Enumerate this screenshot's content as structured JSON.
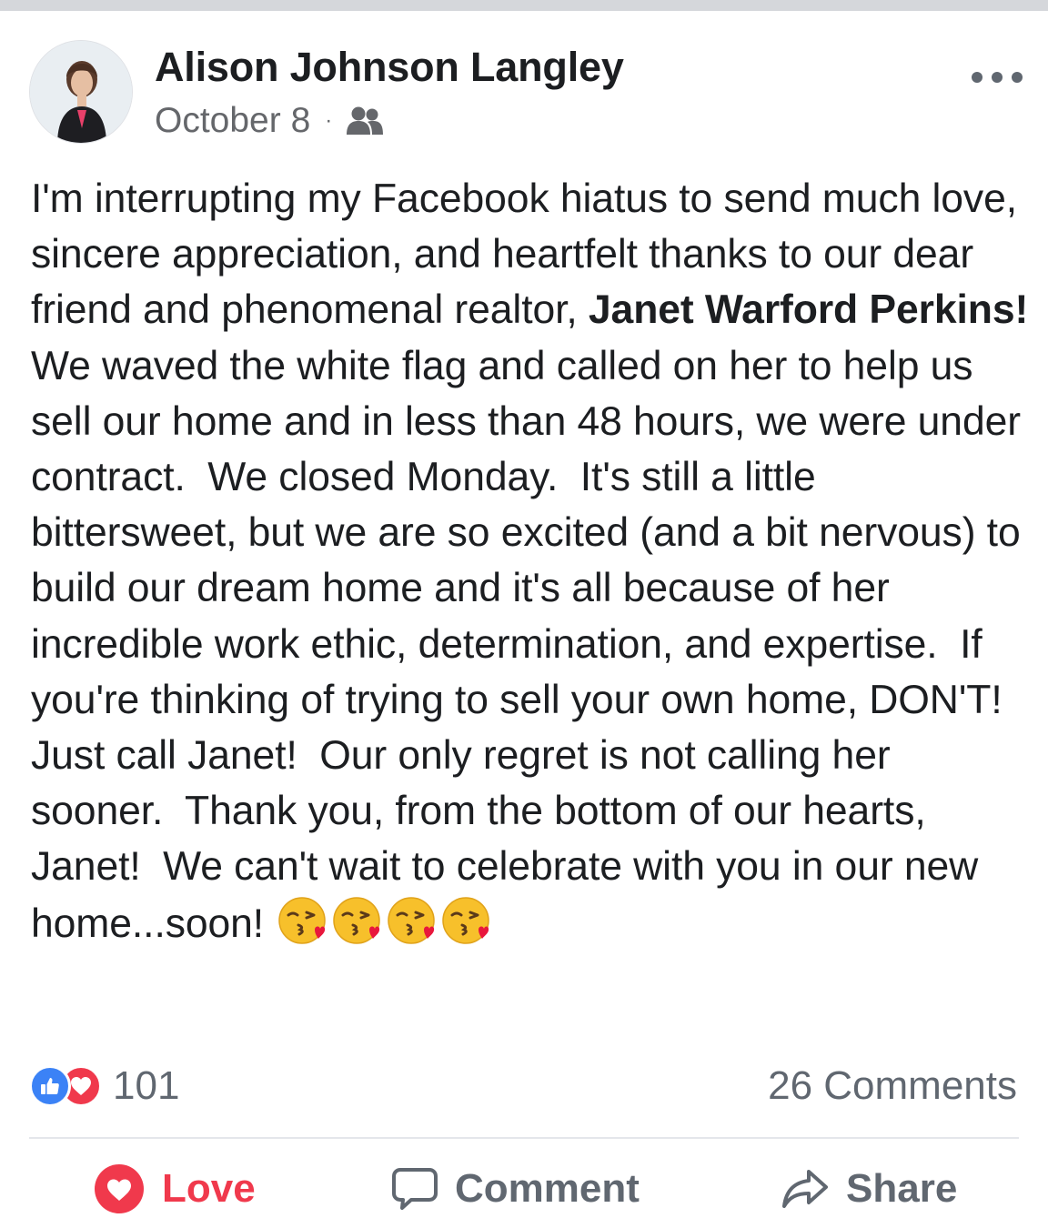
{
  "post": {
    "author": "Alison Johnson Langley",
    "date": "October 8",
    "separator": "·",
    "audience_icon": "friends-icon",
    "more_icon": "more-options-icon",
    "body": {
      "text_before": "I'm interrupting my Facebook hiatus to send much love, sincere appreciation, and heartfelt thanks to our dear friend and phenomenal realtor, ",
      "bold_name": "Janet Warford Perkins!",
      "text_after": "  We waved the white flag and called on her to help us sell our home and in less than 48 hours, we were under contract.  We closed Monday.  It's still a little bittersweet, but we are so excited (and a bit nervous) to build our dream home and it's all because of her incredible work ethic, determination, and expertise.  If you're thinking of trying to sell your own home, DON'T!  Just call Janet!  Our only regret is not calling her sooner.  Thank you, from the bottom of our hearts, Janet!  We can't wait to celebrate with you in our new home...soon!",
      "emojis": [
        "kissing-heart-emoji",
        "kissing-heart-emoji",
        "kissing-heart-emoji",
        "kissing-heart-emoji"
      ]
    },
    "reactions": {
      "icons": [
        "like-icon",
        "love-icon"
      ],
      "count": "101"
    },
    "comments_count": "26 Comments",
    "actions": {
      "love": "Love",
      "comment": "Comment",
      "share": "Share"
    },
    "colors": {
      "love_red": "#f0394c",
      "like_blue": "#3b82f6",
      "secondary_gray": "#606770"
    }
  }
}
